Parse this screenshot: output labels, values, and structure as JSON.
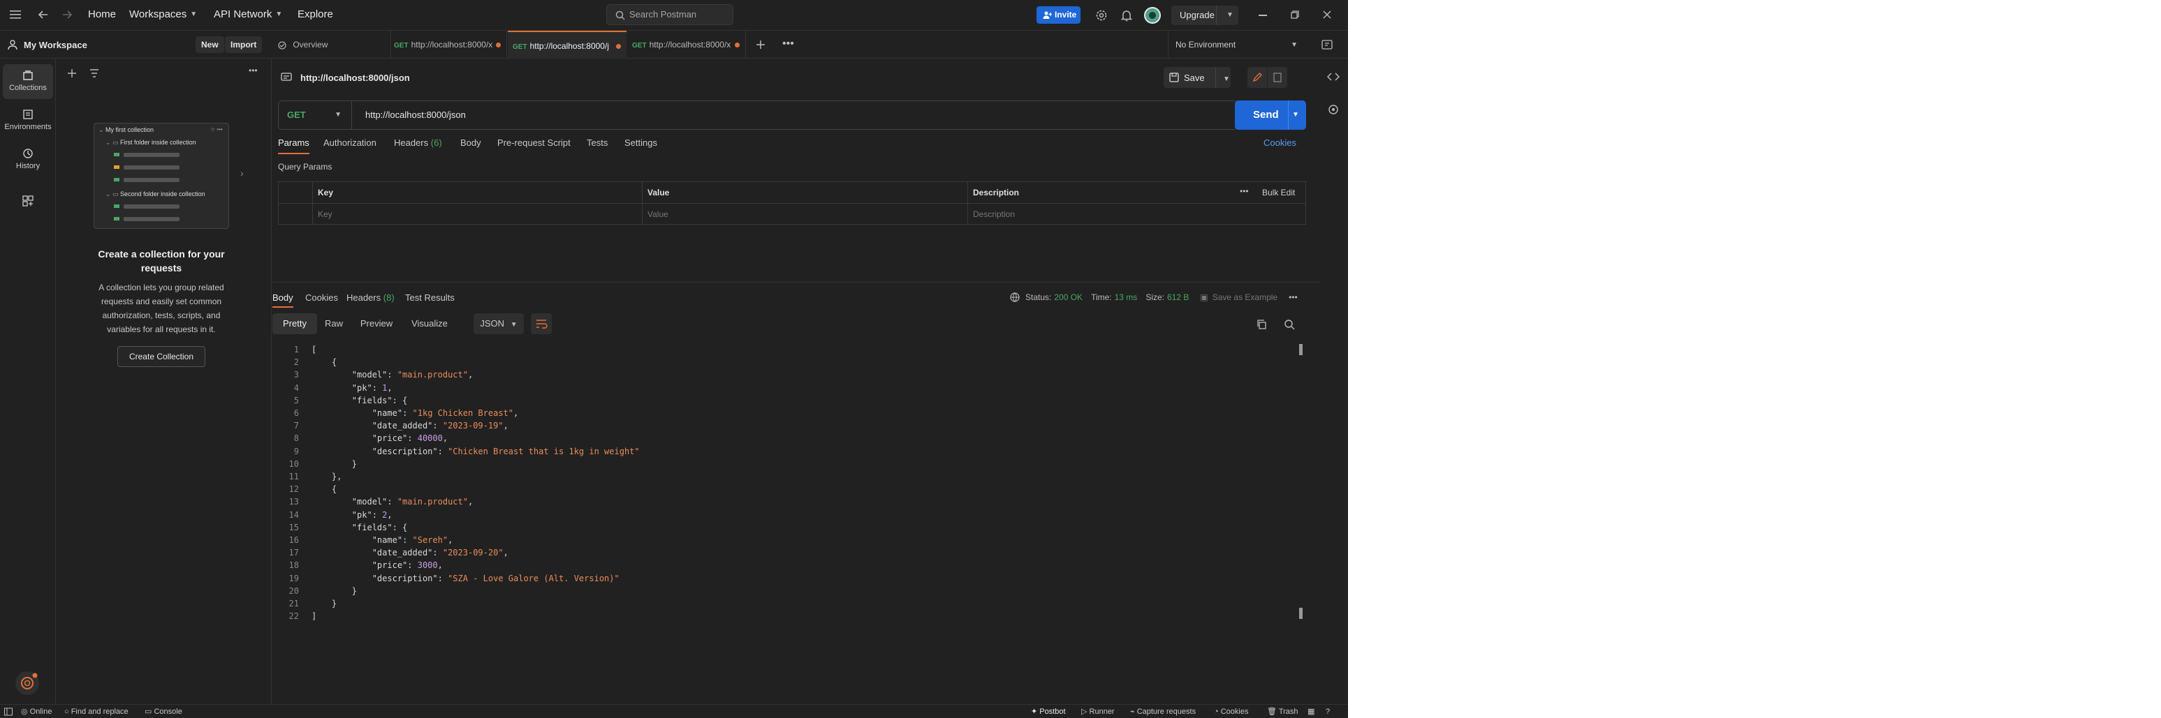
{
  "topbar": {
    "nav": [
      "Home",
      "Workspaces",
      "API Network",
      "Explore"
    ],
    "search_placeholder": "Search Postman",
    "invite_label": "Invite",
    "upgrade_label": "Upgrade"
  },
  "workspace": {
    "name": "My Workspace",
    "new_label": "New",
    "import_label": "Import"
  },
  "tabs": [
    {
      "label": "Overview",
      "method": ""
    },
    {
      "label": "http://localhost:8000/x",
      "method": "GET"
    },
    {
      "label": "http://localhost:8000/j",
      "method": "GET"
    },
    {
      "label": "http://localhost:8000/x",
      "method": "GET"
    }
  ],
  "environment": "No Environment",
  "rail": [
    "Collections",
    "Environments",
    "History"
  ],
  "empty_state": {
    "collection_name": "My first collection",
    "folder1": "First folder inside collection",
    "folder2": "Second folder inside collection",
    "heading": "Create a collection for your requests",
    "body": "A collection lets you group related requests and easily set common authorization, tests, scripts, and variables for all requests in it.",
    "button": "Create Collection"
  },
  "request": {
    "title": "http://localhost:8000/json",
    "save_label": "Save",
    "method": "GET",
    "url": "http://localhost:8000/json",
    "send_label": "Send",
    "subtabs": [
      "Params",
      "Authorization",
      "Headers",
      "Body",
      "Pre-request Script",
      "Tests",
      "Settings"
    ],
    "headers_count": "(6)",
    "cookies_label": "Cookies",
    "query_params_label": "Query Params",
    "table": {
      "headers": [
        "Key",
        "Value",
        "Description"
      ],
      "bulk_edit": "Bulk Edit",
      "placeholders": [
        "Key",
        "Value",
        "Description"
      ]
    }
  },
  "response": {
    "tabs": [
      "Body",
      "Cookies",
      "Headers",
      "Test Results"
    ],
    "headers_count": "(8)",
    "status_label": "Status:",
    "status_value": "200 OK",
    "time_label": "Time:",
    "time_value": "13 ms",
    "size_label": "Size:",
    "size_value": "612 B",
    "save_example": "Save as Example",
    "view_tabs": [
      "Pretty",
      "Raw",
      "Preview",
      "Visualize"
    ],
    "format": "JSON",
    "lines": [
      "[",
      "    {",
      "        \"model\": \"main.product\",",
      "        \"pk\": 1,",
      "        \"fields\": {",
      "            \"name\": \"1kg Chicken Breast\",",
      "            \"date_added\": \"2023-09-19\",",
      "            \"price\": 40000,",
      "            \"description\": \"Chicken Breast that is 1kg in weight\"",
      "        }",
      "    },",
      "    {",
      "        \"model\": \"main.product\",",
      "        \"pk\": 2,",
      "        \"fields\": {",
      "            \"name\": \"Sereh\",",
      "            \"date_added\": \"2023-09-20\",",
      "            \"price\": 3000,",
      "            \"description\": \"SZA - Love Galore (Alt. Version)\"",
      "        }",
      "    }",
      "]"
    ]
  },
  "footer": {
    "online": "Online",
    "find_replace": "Find and replace",
    "console": "Console",
    "postbot": "Postbot",
    "runner": "Runner",
    "capture": "Capture requests",
    "cookies": "Cookies",
    "trash": "Trash"
  },
  "colors": {
    "accent": "#e0703a",
    "primary": "#1f66d6",
    "get_method": "#4aa764",
    "status_ok": "#4aa764"
  }
}
